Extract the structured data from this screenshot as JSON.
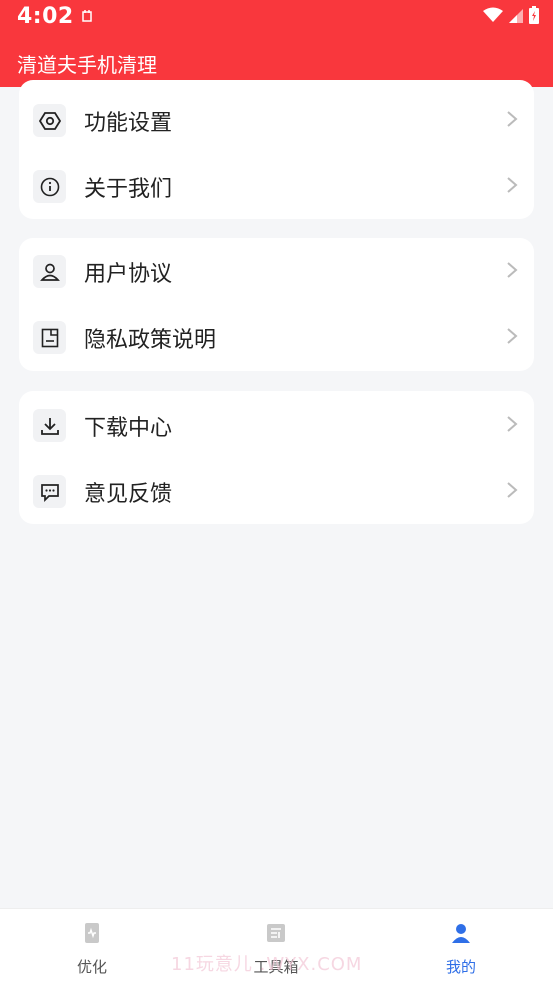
{
  "status_bar": {
    "time": "4:02"
  },
  "app_bar": {
    "title": "清道夫手机清理"
  },
  "menu": {
    "group1": [
      {
        "label": "功能设置",
        "icon": "settings-hexagon-icon"
      },
      {
        "label": "关于我们",
        "icon": "info-icon"
      }
    ],
    "group2": [
      {
        "label": "用户协议",
        "icon": "user-icon"
      },
      {
        "label": "隐私政策说明",
        "icon": "document-icon"
      }
    ],
    "group3": [
      {
        "label": "下载中心",
        "icon": "download-icon"
      },
      {
        "label": "意见反馈",
        "icon": "feedback-chat-icon"
      }
    ]
  },
  "tabs": [
    {
      "label": "优化",
      "icon": "phone-optimize-icon",
      "active": false
    },
    {
      "label": "工具箱",
      "icon": "toolbox-icon",
      "active": false
    },
    {
      "label": "我的",
      "icon": "profile-icon",
      "active": true
    }
  ],
  "watermark": "11玩意儿 .WYX.COM",
  "colors": {
    "brand": "#f9373d",
    "tab_active": "#2f6fe7",
    "background": "#f5f6f8"
  }
}
